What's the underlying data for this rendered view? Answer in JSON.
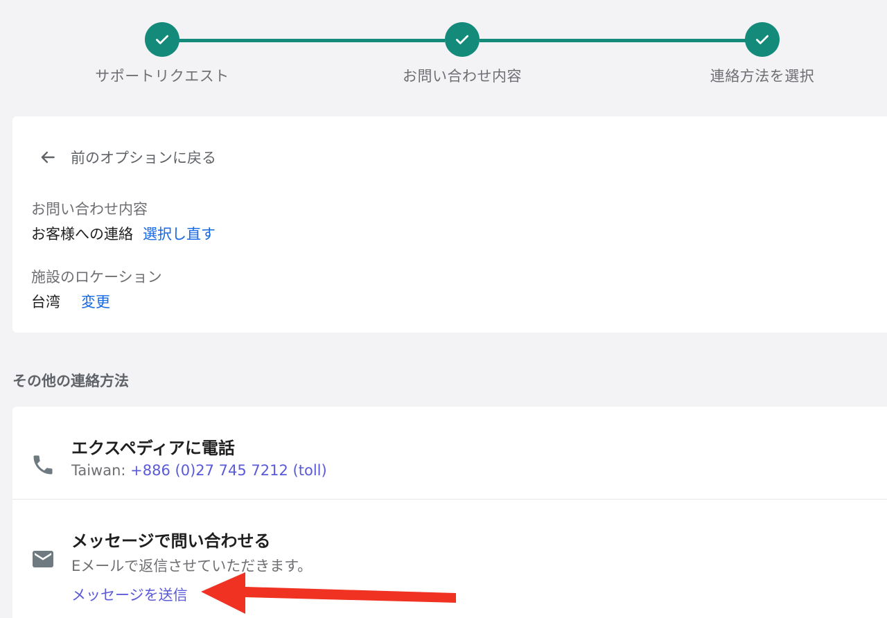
{
  "stepper": {
    "steps": [
      {
        "label": "サポートリクエスト",
        "status": "complete"
      },
      {
        "label": "お問い合わせ内容",
        "status": "complete"
      },
      {
        "label": "連絡方法を選択",
        "status": "complete"
      }
    ],
    "accent_color": "#138a7a",
    "icon": "check-icon"
  },
  "summary": {
    "back_label": "前のオプションに戻る",
    "back_icon": "arrow-left-icon",
    "inquiry": {
      "label": "お問い合わせ内容",
      "value": "お客様への連絡",
      "action": "選択し直す"
    },
    "location": {
      "label": "施設のロケーション",
      "value": "台湾",
      "action": "変更"
    }
  },
  "other_contact": {
    "heading": "その他の連絡方法",
    "phone": {
      "icon": "phone-icon",
      "title": "エクスペディアに電話",
      "region": "Taiwan: ",
      "number": "+886 (0)27 745 7212 (toll)"
    },
    "message": {
      "icon": "mail-icon",
      "title": "メッセージで問い合わせる",
      "description": "Eメールで返信させていただきます。",
      "action": "メッセージを送信"
    }
  },
  "annotation": {
    "icon": "red-arrow-icon",
    "color": "#f03222"
  },
  "colors": {
    "link_blue": "#1668e3",
    "link_violet": "#5a5ad8",
    "background": "#f3f3f5"
  }
}
